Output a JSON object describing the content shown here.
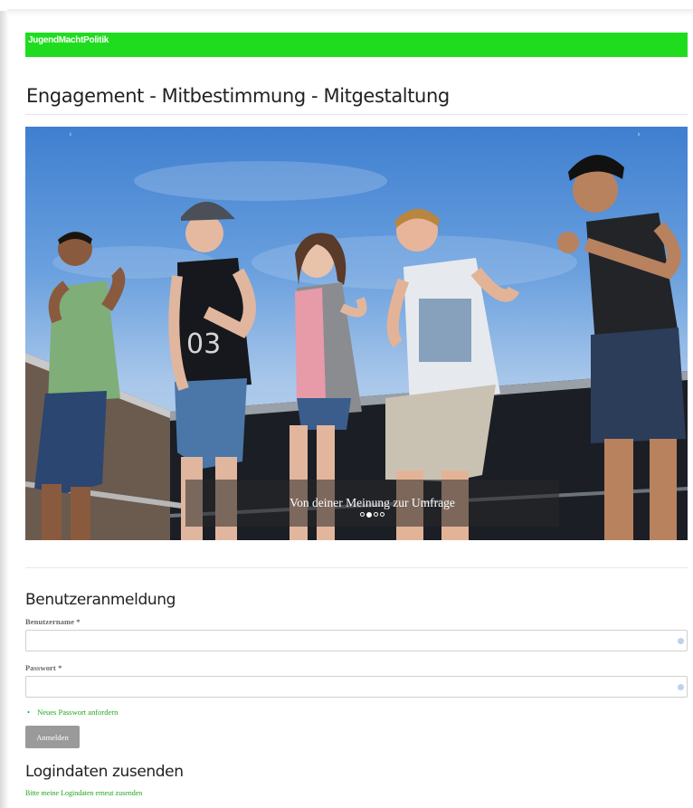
{
  "header": {
    "brand": "JugendMachtPolitik",
    "brand_color": "#1fdc1f"
  },
  "page": {
    "title": "Engagement - Mitbestimmung - Mitgestaltung"
  },
  "carousel": {
    "prev_icon": "chevron-left-icon",
    "next_icon": "chevron-right-icon",
    "prev_glyph": "‹",
    "next_glyph": "›",
    "caption": "Von deiner Meinung zur Umfrage",
    "slide_count": 4,
    "active_index": 1
  },
  "login": {
    "heading": "Benutzeranmeldung",
    "username_label": "Benutzername *",
    "username_value": "",
    "password_label": "Passwort *",
    "password_value": "",
    "links": [
      {
        "label": "Neues Passwort anfordern"
      }
    ],
    "submit_label": "Anmelden",
    "link_color": "#1fa51f"
  },
  "send_credentials": {
    "heading": "Logindaten zusenden",
    "subtext": "Bitte meine Logindaten erneut zusenden"
  }
}
